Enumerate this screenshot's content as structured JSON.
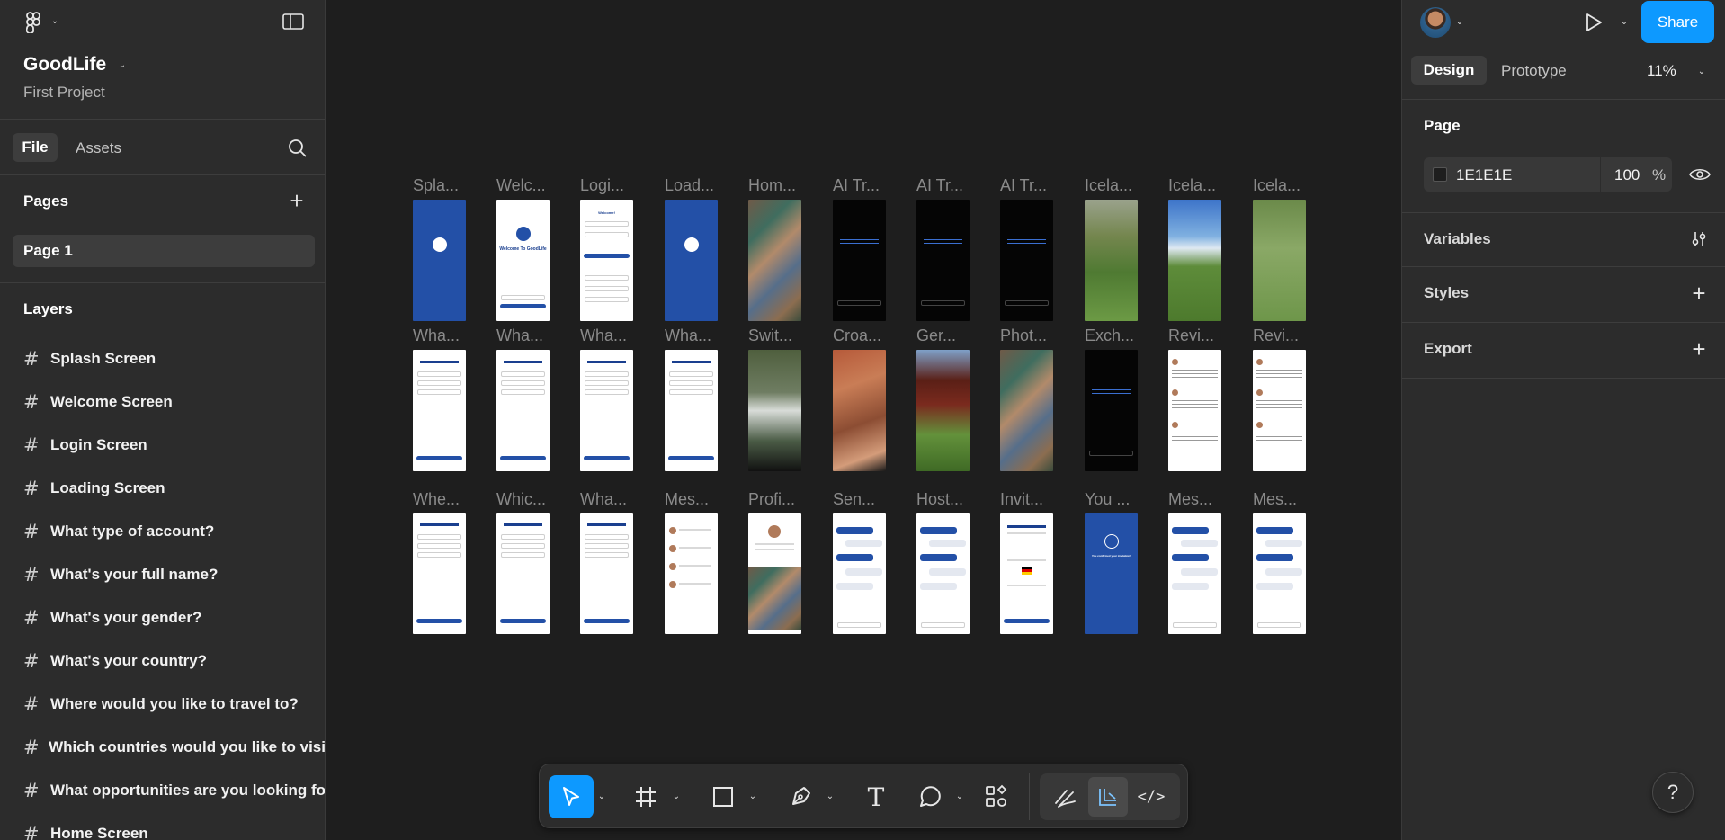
{
  "file": {
    "name": "GoodLife",
    "project": "First Project"
  },
  "left_tabs": {
    "file": "File",
    "assets": "Assets"
  },
  "pages": {
    "title": "Pages",
    "items": [
      "Page 1"
    ]
  },
  "layers": {
    "title": "Layers",
    "items": [
      "Splash Screen",
      "Welcome Screen",
      "Login Screen",
      "Loading Screen",
      "What type of account?",
      "What's your full name?",
      "What's your gender?",
      "What's your country?",
      "Where would you like to travel to?",
      "Which countries would you like to visi",
      "What opportunities are you looking fo",
      "Home Screen"
    ]
  },
  "canvas": {
    "frame_labels": [
      [
        "Spla...",
        "Welc...",
        "Logi...",
        "Load...",
        "Hom...",
        "AI Tr...",
        "AI Tr...",
        "AI Tr...",
        "Icela...",
        "Icela...",
        "Icela..."
      ],
      [
        "Wha...",
        "Wha...",
        "Wha...",
        "Wha...",
        "Swit...",
        "Croa...",
        "Ger...",
        "Phot...",
        "Exch...",
        "Revi...",
        "Revi..."
      ],
      [
        "Whe...",
        "Whic...",
        "Wha...",
        "Mes...",
        "Profi...",
        "Sen...",
        "Host...",
        "Invit...",
        "You ...",
        "Mes...",
        "Mes..."
      ]
    ],
    "frame_types": [
      [
        "blue",
        "welcome",
        "login",
        "blue",
        "photo",
        "black",
        "black",
        "black",
        "grass",
        "field",
        "sheep"
      ],
      [
        "form",
        "form",
        "form",
        "form",
        "river",
        "city",
        "barn",
        "photo",
        "black",
        "review",
        "review"
      ],
      [
        "form",
        "form",
        "form",
        "list",
        "profile",
        "chat",
        "chat",
        "invite",
        "blue-done",
        "chat",
        "chat"
      ]
    ],
    "mini_text": {
      "welcome": "Welcome To GoodLife",
      "login": "Welcome!",
      "done": "You confirmed your invitation!"
    }
  },
  "toolbar": {
    "tools": [
      "move-tool",
      "frame-tool",
      "shape-tool",
      "pen-tool",
      "text-tool",
      "comment-tool",
      "actions-tool"
    ],
    "mode_tools": [
      "draw-mode",
      "design-mode",
      "dev-mode"
    ]
  },
  "right_panel": {
    "share_label": "Share",
    "tabs": {
      "design": "Design",
      "prototype": "Prototype"
    },
    "zoom": "11%",
    "page": {
      "title": "Page",
      "color_hex": "1E1E1E",
      "opacity": "100",
      "opacity_unit": "%"
    },
    "sections": {
      "variables": "Variables",
      "styles": "Styles",
      "export": "Export"
    }
  },
  "help": "?",
  "colors": {
    "accent": "#0d99ff",
    "canvas_bg": "#1e1e1e",
    "panel_bg": "#2c2c2c",
    "frame_blue": "#2350a7"
  }
}
